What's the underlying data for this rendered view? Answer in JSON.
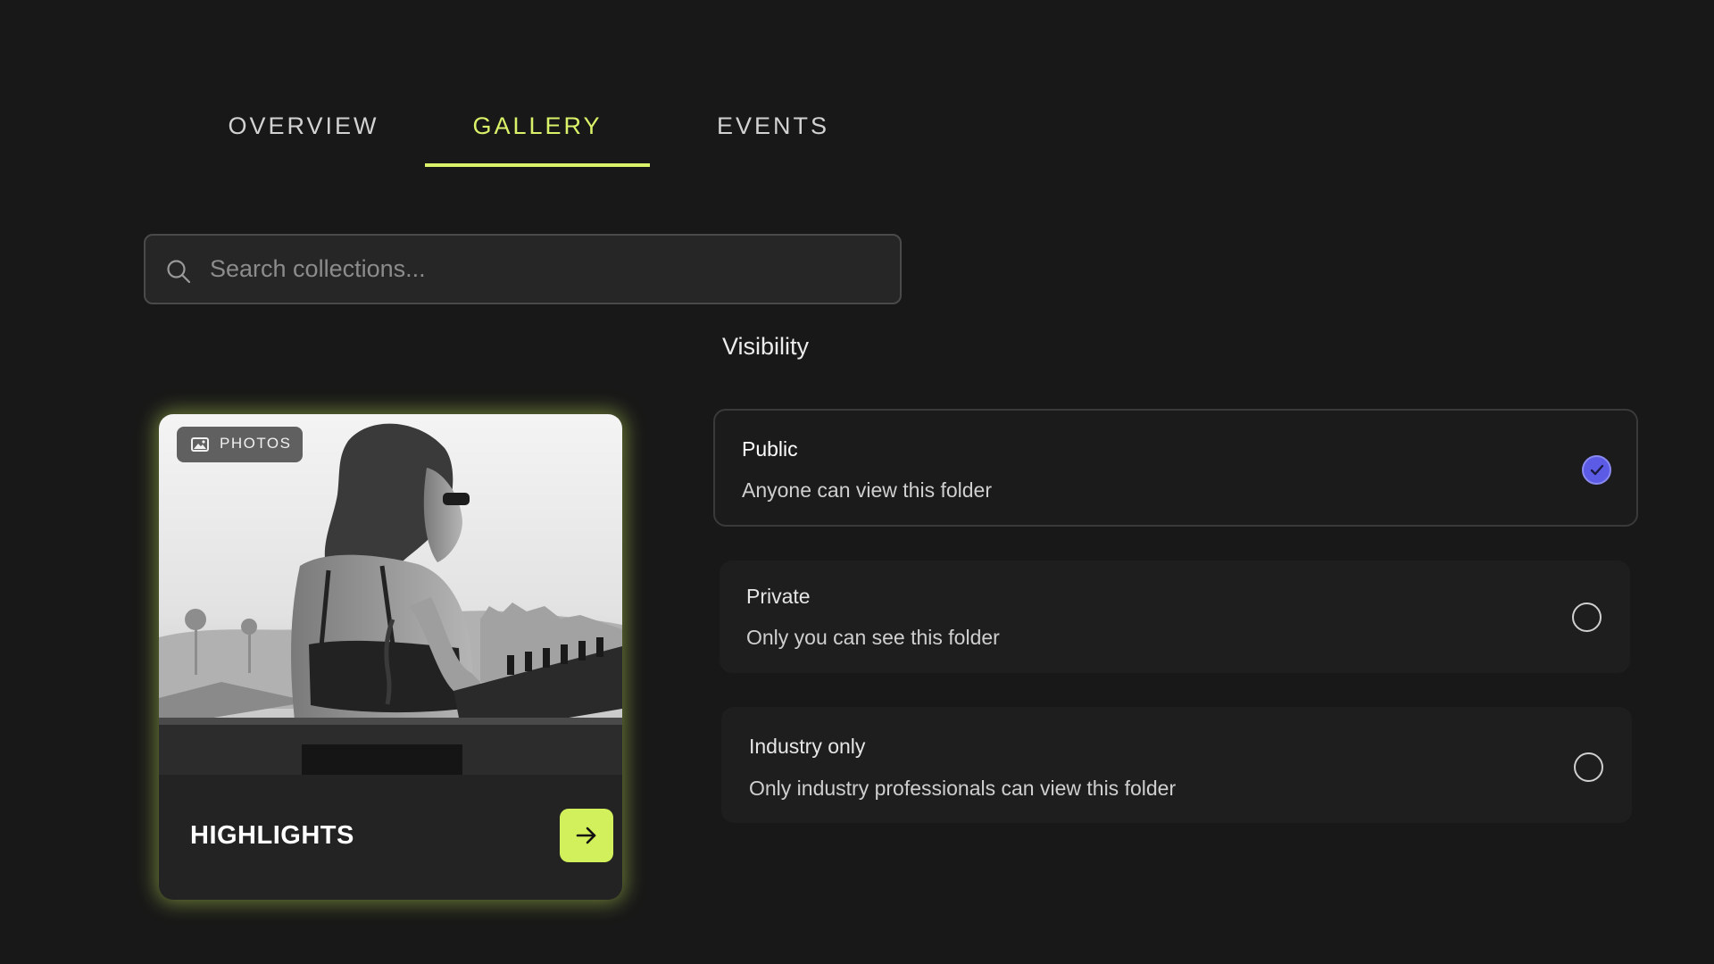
{
  "tabs": [
    {
      "label": "OVERVIEW",
      "active": false
    },
    {
      "label": "GALLERY",
      "active": true
    },
    {
      "label": "EVENTS",
      "active": false
    }
  ],
  "search": {
    "placeholder": "Search collections...",
    "value": ""
  },
  "visibility": {
    "title": "Visibility",
    "options": [
      {
        "label": "Public",
        "description": "Anyone can view this folder",
        "selected": true
      },
      {
        "label": "Private",
        "description": "Only you can see this folder",
        "selected": false
      },
      {
        "label": "Industry only",
        "description": "Only industry professionals can view this folder",
        "selected": false
      }
    ]
  },
  "card": {
    "badge": "PHOTOS",
    "title": "HIGHLIGHTS"
  },
  "colors": {
    "accent": "#d9f26a",
    "radio_checked": "#5b5be6",
    "background": "#181818"
  }
}
